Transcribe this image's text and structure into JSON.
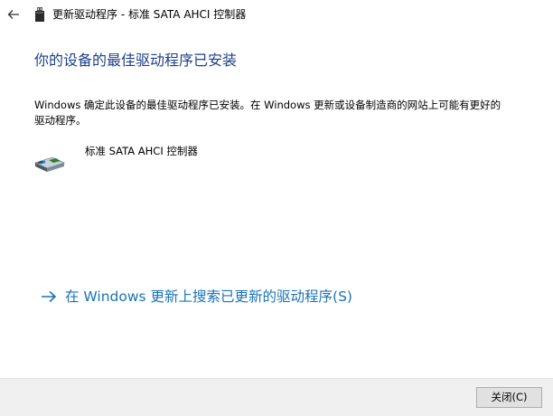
{
  "titlebar": {
    "back_icon": "back-arrow-icon",
    "device_icon": "usb-device-icon",
    "title": "更新驱动程序 - 标准 SATA AHCI 控制器"
  },
  "main": {
    "heading": "你的设备的最佳驱动程序已安装",
    "description": "Windows 确定此设备的最佳驱动程序已安装。在 Windows 更新或设备制造商的网站上可能有更好的驱动程序。",
    "device_icon": "storage-controller-icon",
    "device_name": "标准 SATA AHCI 控制器",
    "search_link": {
      "icon": "right-arrow-icon",
      "label": "在 Windows 更新上搜索已更新的驱动程序(S)"
    }
  },
  "footer": {
    "close_label": "关闭(C)"
  },
  "colors": {
    "heading": "#1e3f8a",
    "link": "#1a73b7",
    "footer_bg": "#f0f0f0"
  }
}
